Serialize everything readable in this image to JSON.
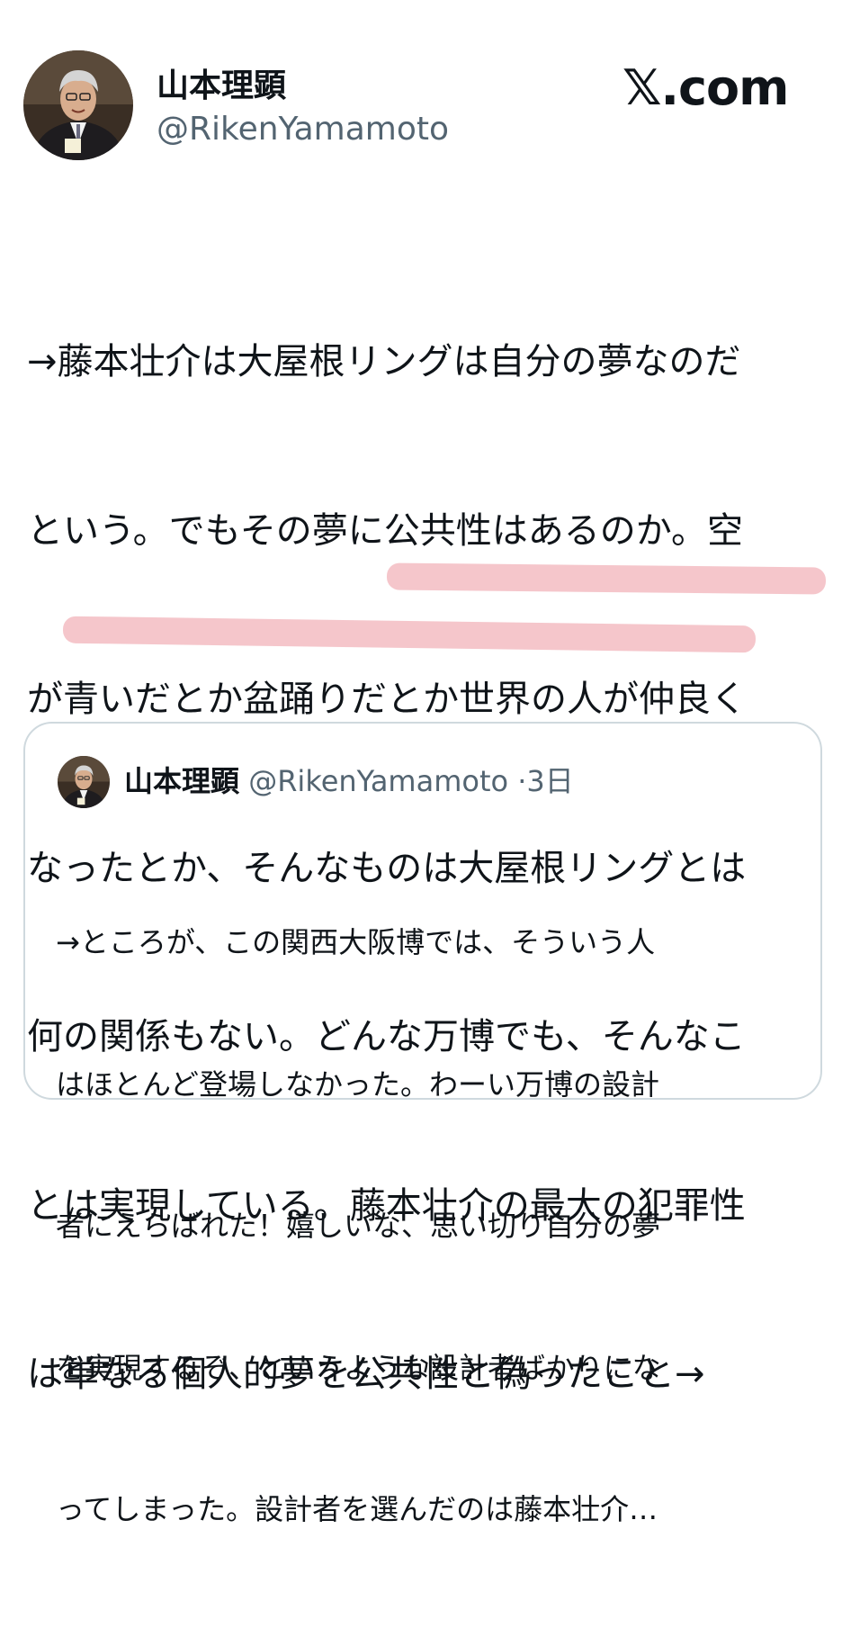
{
  "post": {
    "author_name": "山本理顕",
    "author_handle": "@RikenYamamoto",
    "site_logo": "𝕏.com",
    "text_lines": [
      "→藤本壮介は大屋根リングは自分の夢なのだ",
      "という。でもその夢に公共性はあるのか。空",
      "が青いだとか盆踊りだとか世界の人が仲良く",
      "なったとか、そんなものは大屋根リングとは",
      "何の関係もない。どんな万博でも、そんなこ",
      "とは実現している。藤本壮介の最大の犯罪性",
      "は単なる個人的夢を公共性と偽ったこと→"
    ],
    "highlight_color": "#e67882"
  },
  "quote": {
    "author_name": "山本理顕",
    "author_handle": "@RikenYamamoto",
    "separator": "·",
    "time": "3日",
    "text_lines": [
      "→ところが、この関西大阪博では、そういう人",
      "はほとんど登場しなかった。わーい万博の設計",
      "者にえらばれた！嬉しいな、思い切り自分の夢",
      "を実現するぞ、というような設計者ばかりにな",
      "ってしまった。設計者を選んだのは藤本壮介…"
    ]
  }
}
